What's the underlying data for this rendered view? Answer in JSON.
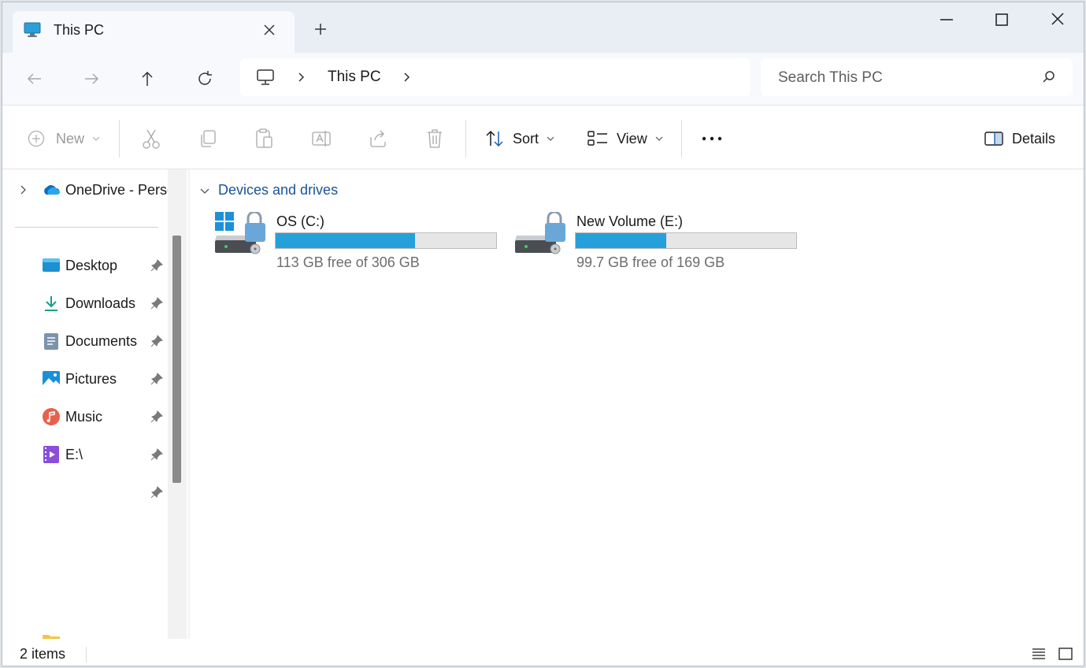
{
  "window": {
    "tab_title": "This PC",
    "tab_icon": "monitor-icon",
    "controls": [
      "minimize-icon",
      "maximize-icon",
      "close-icon"
    ]
  },
  "nav": {
    "breadcrumb": [
      "This PC"
    ],
    "search_placeholder": "Search This PC"
  },
  "toolbar": {
    "new_label": "New",
    "sort_label": "Sort",
    "view_label": "View",
    "details_label": "Details",
    "disabled_actions": [
      "cut-icon",
      "copy-icon",
      "paste-icon",
      "rename-icon",
      "share-icon",
      "delete-icon"
    ],
    "more_icon": "more-icon"
  },
  "sidebar": {
    "onedrive_label": "OneDrive - Perso",
    "items": [
      {
        "label": "Desktop",
        "icon": "desktop-icon",
        "pinned": true
      },
      {
        "label": "Downloads",
        "icon": "downloads-icon",
        "pinned": true
      },
      {
        "label": "Documents",
        "icon": "documents-icon",
        "pinned": true
      },
      {
        "label": "Pictures",
        "icon": "pictures-icon",
        "pinned": true
      },
      {
        "label": "Music",
        "icon": "music-icon",
        "pinned": true
      },
      {
        "label": "E:\\",
        "icon": "videos-icon",
        "pinned": true
      },
      {
        "label": "",
        "icon": "",
        "pinned": true
      }
    ]
  },
  "content": {
    "group_title": "Devices and drives",
    "drives": [
      {
        "name": "OS (C:)",
        "space": "113 GB free of 306 GB",
        "used_fraction": 0.631
      },
      {
        "name": "New Volume (E:)",
        "space": "99.7 GB free of 169 GB",
        "used_fraction": 0.41
      }
    ]
  },
  "status": {
    "item_count": "2 items"
  },
  "colors": {
    "accent": "#26a0da",
    "link": "#1a5396",
    "chrome": "#e9eef5"
  }
}
